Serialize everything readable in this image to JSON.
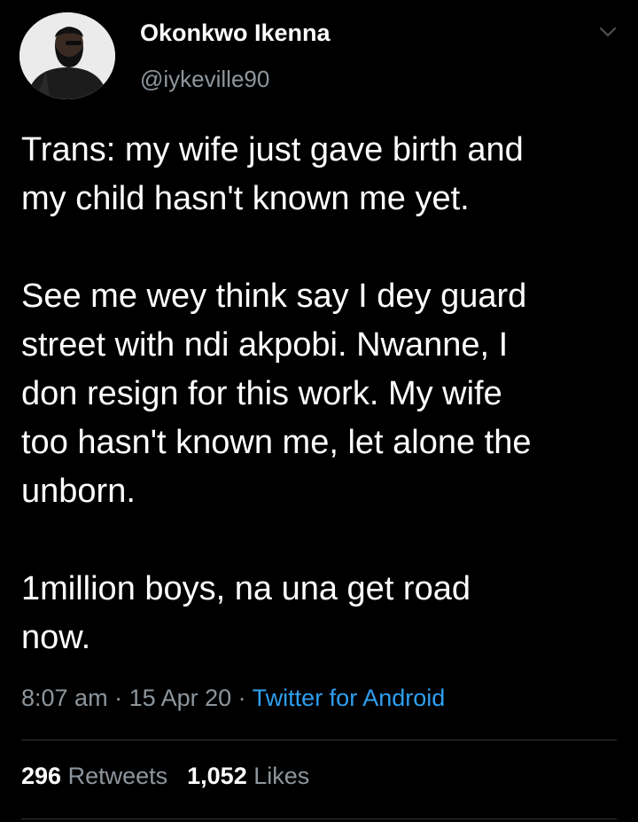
{
  "tweet": {
    "author": {
      "name": "Okonkwo Ikenna",
      "handle": "@iykeville90"
    },
    "text": "Trans: my wife just gave birth and\nmy child hasn't known me yet.\n\nSee me wey think say I dey guard\nstreet with ndi akpobi. Nwanne, I\ndon resign for this work. My wife\ntoo hasn't known me, let alone the\nunborn.\n\n1million boys, na una get road\nnow.",
    "time": "8:07 am",
    "sep1": " · ",
    "date": "15 Apr 20",
    "sep2": " · ",
    "source": "Twitter for Android",
    "retweets_count": "296",
    "retweets_label": "Retweets",
    "likes_count": "1,052",
    "likes_label": "Likes"
  },
  "colors": {
    "background": "#000000",
    "text": "#ffffff",
    "secondary": "#8e969d",
    "link": "#2f9ff0",
    "divider": "#2f3336"
  },
  "icons": {
    "menu": "chevron-down-icon"
  }
}
